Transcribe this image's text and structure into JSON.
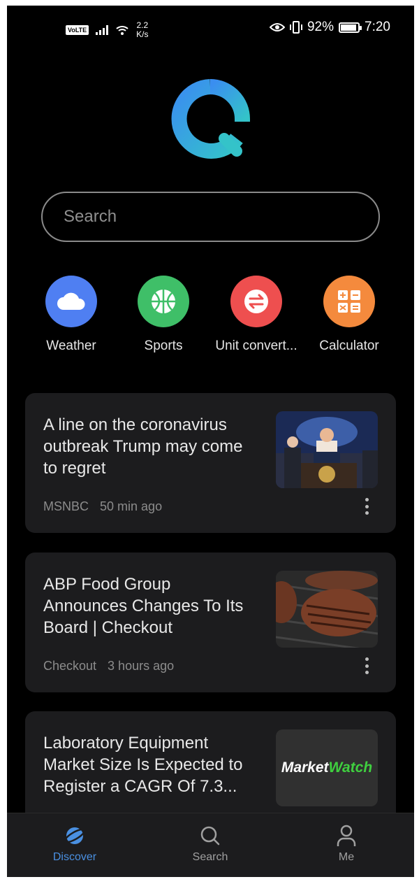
{
  "status_bar": {
    "volte": "VoLTE",
    "speed_value": "2.2",
    "speed_unit": "K/s",
    "battery": "92%",
    "battery_level": 0.92,
    "time": "7:20"
  },
  "search": {
    "placeholder": "Search"
  },
  "shortcuts": [
    {
      "label": "Weather",
      "color": "#4f7ff2",
      "icon": "cloud-icon"
    },
    {
      "label": "Sports",
      "color": "#3fbf68",
      "icon": "basketball-icon"
    },
    {
      "label": "Unit convert...",
      "color": "#ee4f4f",
      "icon": "swap-arrows-icon"
    },
    {
      "label": "Calculator",
      "color": "#f48a3d",
      "icon": "calculator-icon"
    }
  ],
  "news": [
    {
      "title": "A line on the coronavirus outbreak Trump may come to regret",
      "source": "MSNBC",
      "time": "50 min ago"
    },
    {
      "title": "ABP Food Group Announces Changes To Its Board | Checkout",
      "source": "Checkout",
      "time": "3 hours ago"
    },
    {
      "title": "Laboratory Equipment Market Size Is Expected to Register a CAGR Of 7.3...",
      "thumb_brand_a": "Market",
      "thumb_brand_b": "Watch"
    }
  ],
  "bottom_nav": [
    {
      "label": "Discover",
      "active": true
    },
    {
      "label": "Search",
      "active": false
    },
    {
      "label": "Me",
      "active": false
    }
  ],
  "colors": {
    "accent": "#4a90e2",
    "card": "#1c1c1e",
    "background": "#000000"
  }
}
